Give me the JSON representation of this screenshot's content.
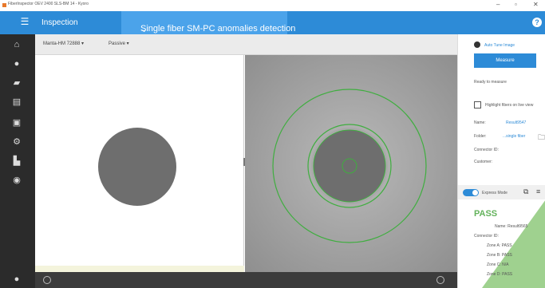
{
  "window": {
    "title": "FiberInspector OEV 2400 SLS-BM 14 - Kyoro",
    "controls": [
      "–",
      "▫",
      "✕"
    ]
  },
  "header": {
    "module": "Inspection",
    "tab_title": "Single fiber SM-PC anomalies detection",
    "tab_chevron": "⌄",
    "help_glyph": "?"
  },
  "nav": {
    "icons": [
      "home-icon",
      "circle-icon",
      "map-icon",
      "doc-icon",
      "layers-icon",
      "gear-icon",
      "users-icon",
      "target-icon",
      "user-icon"
    ]
  },
  "toolbar": {
    "camera": "Manta-HM 72888 ▾",
    "mode": "Passive ▾"
  },
  "panel": {
    "auto_tune": "Auto Tune Image",
    "measure": "Measure",
    "status": "Ready to measure",
    "highlight": "Highlight fibers on live view",
    "name_label": "Name:",
    "name_value": "Result9547",
    "folder_label": "Folder:",
    "folder_value": "...single fiber",
    "connector_label": "Connector ID:",
    "customer_label": "Customer:",
    "express_mode": "Express Mode"
  },
  "result": {
    "status": "PASS",
    "lines": [
      "Name: Result9565",
      "Connector ID:",
      "Zone A: PASS",
      "Zone B: PASS",
      "Zone C: N/A",
      "Zone D: PASS"
    ]
  },
  "colors": {
    "accent": "#2d8bd7",
    "pass": "#63b25b",
    "overlay": "#3fae3f"
  }
}
